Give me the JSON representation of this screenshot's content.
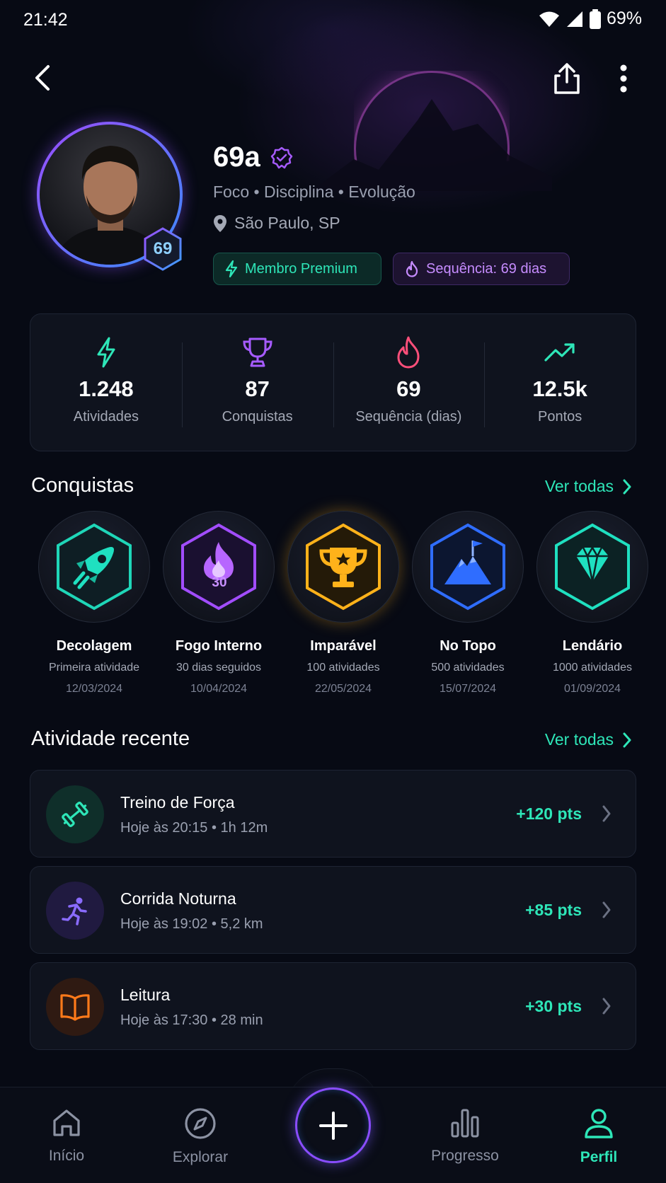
{
  "status_bar": {
    "time": "21:42",
    "battery": "69%"
  },
  "profile": {
    "name": "69a",
    "tagline": "Foco • Disciplina • Evolução",
    "location": "São Paulo, SP",
    "level": "69",
    "badges": {
      "premium": "Membro Premium",
      "streak": "Sequência: 69 dias"
    }
  },
  "stats": [
    {
      "value": "1.248",
      "label": "Atividades",
      "icon": "bolt-icon",
      "color": "#2ee6b8"
    },
    {
      "value": "87",
      "label": "Conquistas",
      "icon": "trophy-icon",
      "color": "#a65bff"
    },
    {
      "value": "69",
      "label": "Sequência (dias)",
      "icon": "flame-icon",
      "color": "#ff4f7a"
    },
    {
      "value": "12.5k",
      "label": "Pontos",
      "icon": "trend-up-icon",
      "color": "#2ee6b8"
    }
  ],
  "achievements_section": {
    "title": "Conquistas",
    "see_all": "Ver todas"
  },
  "achievements": [
    {
      "name": "Decolagem",
      "desc": "Primeira atividade",
      "date": "12/03/2024",
      "icon": "rocket-icon",
      "color": "#1fd6b8"
    },
    {
      "name": "Fogo Interno",
      "desc": "30 dias seguidos",
      "date": "10/04/2024",
      "icon": "flame-icon",
      "color": "#a24dff",
      "badge_number": "30"
    },
    {
      "name": "Imparável",
      "desc": "100 atividades",
      "date": "22/05/2024",
      "icon": "trophy-icon",
      "color": "#ffb21a"
    },
    {
      "name": "No Topo",
      "desc": "500 atividades",
      "date": "15/07/2024",
      "icon": "mountain-flag-icon",
      "color": "#2f6dff"
    },
    {
      "name": "Lendário",
      "desc": "1000 atividades",
      "date": "01/09/2024",
      "icon": "diamond-icon",
      "color": "#1fe0c0"
    }
  ],
  "activity_section": {
    "title": "Atividade recente",
    "see_all": "Ver todas"
  },
  "activities": [
    {
      "title": "Treino de Força",
      "subtitle": "Hoje às 20:15 • 1h 12m",
      "points": "+120 pts",
      "icon": "dumbbell-icon",
      "color": "#2ee6b8"
    },
    {
      "title": "Corrida Noturna",
      "subtitle": "Hoje às 19:02 • 5,2 km",
      "points": "+85 pts",
      "icon": "runner-icon",
      "color": "#8a6bff"
    },
    {
      "title": "Leitura",
      "subtitle": "Hoje às 17:30 • 28 min",
      "points": "+30 pts",
      "icon": "book-icon",
      "color": "#ff7a1a"
    }
  ],
  "bottom_nav": [
    {
      "label": "Início",
      "icon": "home-icon"
    },
    {
      "label": "Explorar",
      "icon": "compass-icon"
    },
    {
      "label": "Progresso",
      "icon": "bar-chart-icon"
    },
    {
      "label": "Perfil",
      "icon": "user-icon",
      "active": true
    }
  ]
}
